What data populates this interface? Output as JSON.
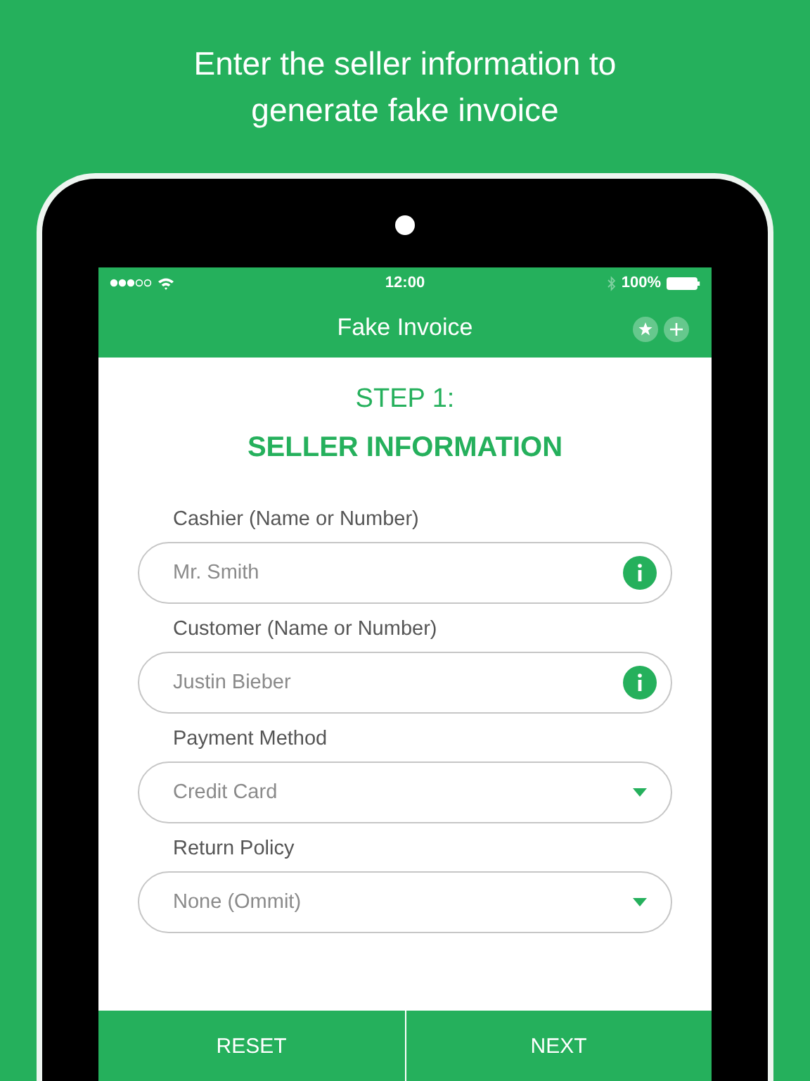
{
  "headline": "Enter the seller information to generate fake invoice",
  "status_bar": {
    "time": "12:00",
    "battery": "100%"
  },
  "nav_bar": {
    "title": "Fake Invoice"
  },
  "step": {
    "number": "STEP 1:",
    "title": "SELLER INFORMATION"
  },
  "fields": [
    {
      "label": "Cashier (Name or Number)",
      "placeholder": "Mr. Smith",
      "kind": "text"
    },
    {
      "label": "Customer (Name or Number)",
      "placeholder": "Justin Bieber",
      "kind": "text"
    },
    {
      "label": "Payment Method",
      "value": "Credit Card",
      "kind": "select"
    },
    {
      "label": "Return Policy",
      "value": "None (Ommit)",
      "kind": "select"
    }
  ],
  "buttons": [
    "RESET",
    "NEXT"
  ]
}
